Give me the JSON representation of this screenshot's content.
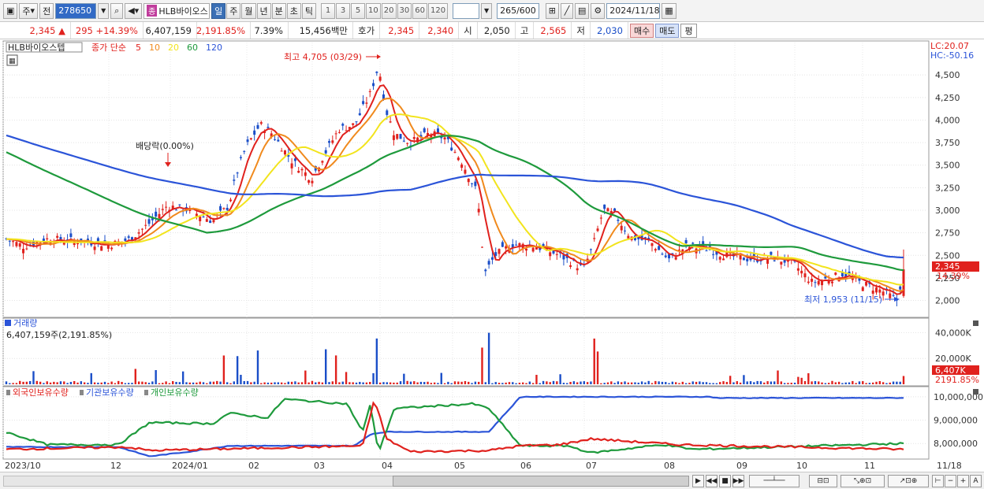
{
  "toolbar": {
    "type_label": "주",
    "prev_label": "전",
    "code": "278650",
    "jong_badge": "종",
    "stock_name": "HLB바이오스",
    "periods": [
      "일",
      "주",
      "월",
      "년",
      "분",
      "초",
      "틱"
    ],
    "active_period": "일",
    "intervals": [
      "1",
      "3",
      "5",
      "10",
      "20",
      "30",
      "60",
      "120"
    ],
    "count": "265",
    "count_total": "/600",
    "date": "2024/11/18"
  },
  "quote": {
    "price": "2,345",
    "change_arrow": "▲",
    "change": "295",
    "change_pct": "+14.39%",
    "volume": "6,407,159",
    "volume_pct": "2,191.85%",
    "turnover_pct": "7.39%",
    "amount": "15,456백만",
    "hoga_label": "호가",
    "ask": "2,345",
    "bid": "2,340",
    "open_label": "시",
    "open": "2,050",
    "high_label": "고",
    "high": "2,565",
    "low_label": "저",
    "low": "2,030",
    "buy_label": "매수",
    "sell_label": "매도",
    "eval_label": "평"
  },
  "price_panel": {
    "series_name": "HLB바이오스텝",
    "ma_label": "종가 단순",
    "ma_periods": [
      "5",
      "10",
      "20",
      "60",
      "120"
    ],
    "ma_colors": [
      "#e0211d",
      "#f08a1d",
      "#f2e41d",
      "#1e9a3c",
      "#2b54d8"
    ],
    "lc": "LC:20.07",
    "hc": "HC:-50.16",
    "high_note": "최고 4,705 (03/29)",
    "low_note": "최저 1,953 (11/15)",
    "dividend_note": "배당락(0.00%)",
    "current_price_box": "2,345",
    "current_pct": "14.39%",
    "y_ticks": [
      "4,500",
      "4,250",
      "4,000",
      "3,750",
      "3,500",
      "3,250",
      "3,000",
      "2,750",
      "2,500",
      "2,250",
      "2,000"
    ]
  },
  "volume_panel": {
    "title": "거래량",
    "info": "6,407,159주(2,191.85%)",
    "y_ticks": [
      "40,000K",
      "20,000K"
    ],
    "current_box": "6,407K",
    "current_pct": "2191.85%"
  },
  "holding_panel": {
    "legend": [
      "외국인보유수량",
      "기관보유수량",
      "개인보유수량"
    ],
    "legend_colors": [
      "#e0211d",
      "#2b54d8",
      "#1e9a3c"
    ],
    "y_ticks": [
      "10,000,000",
      "9,000,000",
      "8,000,000"
    ]
  },
  "x_axis": {
    "labels": [
      "2023/10",
      "12",
      "2024/01",
      "02",
      "03",
      "04",
      "05",
      "06",
      "07",
      "08",
      "09",
      "10",
      "11",
      "11/18"
    ]
  },
  "chart_data": {
    "type": "candlestick",
    "title": "HLB바이오스텝",
    "x_range": [
      "2023-10",
      "2024-11-18"
    ],
    "ylim": [
      1900,
      4650
    ],
    "grid": true,
    "close_approx": [
      [
        "2023/10",
        2700
      ],
      [
        "2023/11",
        2650
      ],
      [
        "2023/12",
        2650
      ],
      [
        "2024/01",
        3150
      ],
      [
        "2024/02",
        3800
      ],
      [
        "2024/03",
        4200
      ],
      [
        "2024/04",
        3800
      ],
      [
        "2024/05",
        3350
      ],
      [
        "2024/06",
        2600
      ],
      [
        "2024/07",
        2900
      ],
      [
        "2024/08",
        2600
      ],
      [
        "2024/09",
        2450
      ],
      [
        "2024/10",
        2150
      ],
      [
        "2024/11/15",
        1953
      ],
      [
        "2024/11/18",
        2345
      ]
    ],
    "highest": {
      "value": 4705,
      "date": "03/29"
    },
    "lowest": {
      "value": 1953,
      "date": "11/15"
    },
    "last": {
      "open": 2050,
      "high": 2565,
      "low": 2030,
      "close": 2345,
      "change_pct": 14.39
    },
    "volume_last": 6407159,
    "volume_ylim": [
      0,
      50000000
    ],
    "holdings_ylim": [
      7400000,
      10300000
    ],
    "holdings_last": {
      "institution": 10000000
    }
  }
}
